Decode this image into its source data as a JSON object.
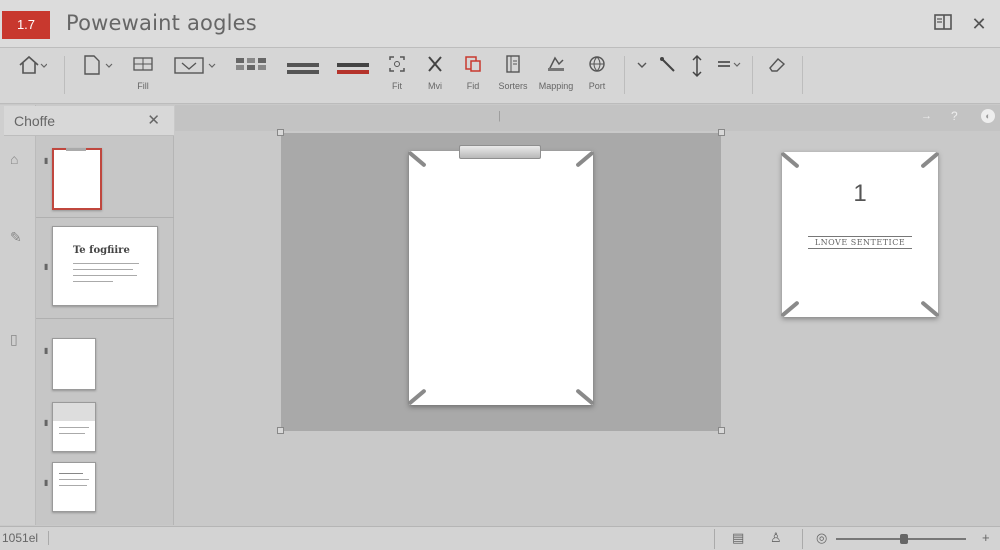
{
  "app": {
    "badge": "1.7",
    "title": "Powewaint aogles"
  },
  "window": {
    "panel_icon": "panel-toggle-icon",
    "close_glyph": "✕"
  },
  "ribbon": {
    "items": [
      {
        "name": "home",
        "label": "",
        "icon": "home-icon"
      },
      {
        "name": "new",
        "label": "",
        "icon": "page-icon"
      },
      {
        "name": "fill",
        "label": "Fill",
        "icon": "grid-icon"
      },
      {
        "name": "shape",
        "label": "",
        "icon": "screen-icon"
      },
      {
        "name": "arrange",
        "label": "",
        "icon": "blocks-icon"
      },
      {
        "name": "lines-gray",
        "label": "",
        "icon": "bars-icon"
      },
      {
        "name": "lines-red",
        "label": "",
        "icon": "bars-icon"
      },
      {
        "name": "fit",
        "label": "Fit",
        "icon": "frame-icon"
      },
      {
        "name": "mvi",
        "label": "Mvi",
        "icon": "close-x-icon"
      },
      {
        "name": "fid",
        "label": "Fid",
        "icon": "copy-icon"
      },
      {
        "name": "sorters",
        "label": "Sorters",
        "icon": "book-icon"
      },
      {
        "name": "mapping",
        "label": "Mapping",
        "icon": "mapping-icon"
      },
      {
        "name": "port",
        "label": "Port",
        "icon": "globe-icon"
      }
    ],
    "accent_red": "#c8382e"
  },
  "left_panel": {
    "title": "Choffe",
    "close": "✕",
    "thumb_title": "Te fogfiire"
  },
  "slide_preview": {
    "number": "1",
    "subtitle": "LNOVE SENTETICE"
  },
  "statusbar": {
    "text": "1051el"
  }
}
